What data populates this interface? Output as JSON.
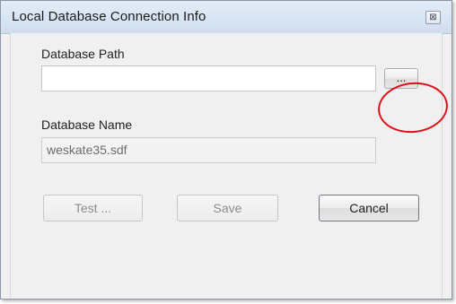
{
  "window": {
    "title": "Local Database Connection Info",
    "close_glyph": "⊠"
  },
  "form": {
    "path_label": "Database Path",
    "path_value": "",
    "browse_label": "...",
    "name_label": "Database Name",
    "name_value": "weskate35.sdf"
  },
  "buttons": {
    "test": "Test ...",
    "save": "Save",
    "cancel": "Cancel"
  },
  "colors": {
    "annotation": "#e0101a",
    "titlebar": "#d8e4f3",
    "dialog_bg": "#f0f0f0"
  }
}
